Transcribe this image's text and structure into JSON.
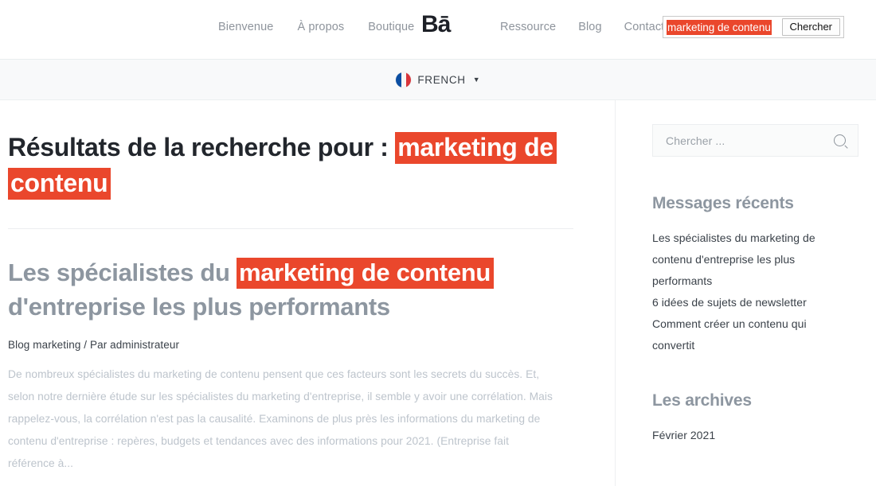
{
  "header": {
    "logo": "Bā",
    "nav_left": [
      {
        "label": "Bienvenue"
      },
      {
        "label": "À propos"
      },
      {
        "label": "Boutique"
      }
    ],
    "nav_right": [
      {
        "label": "Ressource"
      },
      {
        "label": "Blog"
      },
      {
        "label": "Contact"
      }
    ],
    "search": {
      "value": "marketing de contenu",
      "selected": true,
      "button_label": "Chercher"
    }
  },
  "language_bar": {
    "flag_icon": "french-flag-icon",
    "label": "FRENCH",
    "caret": "▼"
  },
  "main": {
    "page_title_prefix": "Résultats de la recherche pour :",
    "page_title_query": "marketing de contenu",
    "post": {
      "title_before": "Les spécialistes du",
      "title_highlight": "marketing de contenu",
      "title_after": "d'entreprise les plus performants",
      "meta": "Blog marketing / Par administrateur",
      "excerpt": "De nombreux spécialistes du marketing de contenu pensent que ces facteurs sont les secrets du succès. Et, selon notre dernière étude sur les spécialistes du marketing d'entreprise, il semble y avoir une corrélation. Mais rappelez-vous, la corrélation n'est pas la causalité. Examinons de plus près les informations du marketing de contenu d'entreprise : repères, budgets et tendances avec des informations pour 2021. (Entreprise fait référence à..."
    }
  },
  "sidebar": {
    "search_placeholder": "Chercher ...",
    "search_icon": "search-icon",
    "recent_heading": "Messages récents",
    "recent_items": [
      {
        "label": "Les spécialistes du marketing de contenu d'entreprise les plus performants"
      },
      {
        "label": "6 idées de sujets de newsletter"
      },
      {
        "label": "Comment créer un contenu qui convertit"
      }
    ],
    "archives_heading": "Les archives",
    "archives_items": [
      {
        "label": "Février 2021"
      }
    ]
  },
  "colors": {
    "highlight": "#ea472c",
    "heading_dark": "#22262c",
    "heading_gray": "#8d96a0",
    "body_text": "#3a4149",
    "muted_text": "#bdc4cc",
    "nav_link": "#8e949c"
  }
}
